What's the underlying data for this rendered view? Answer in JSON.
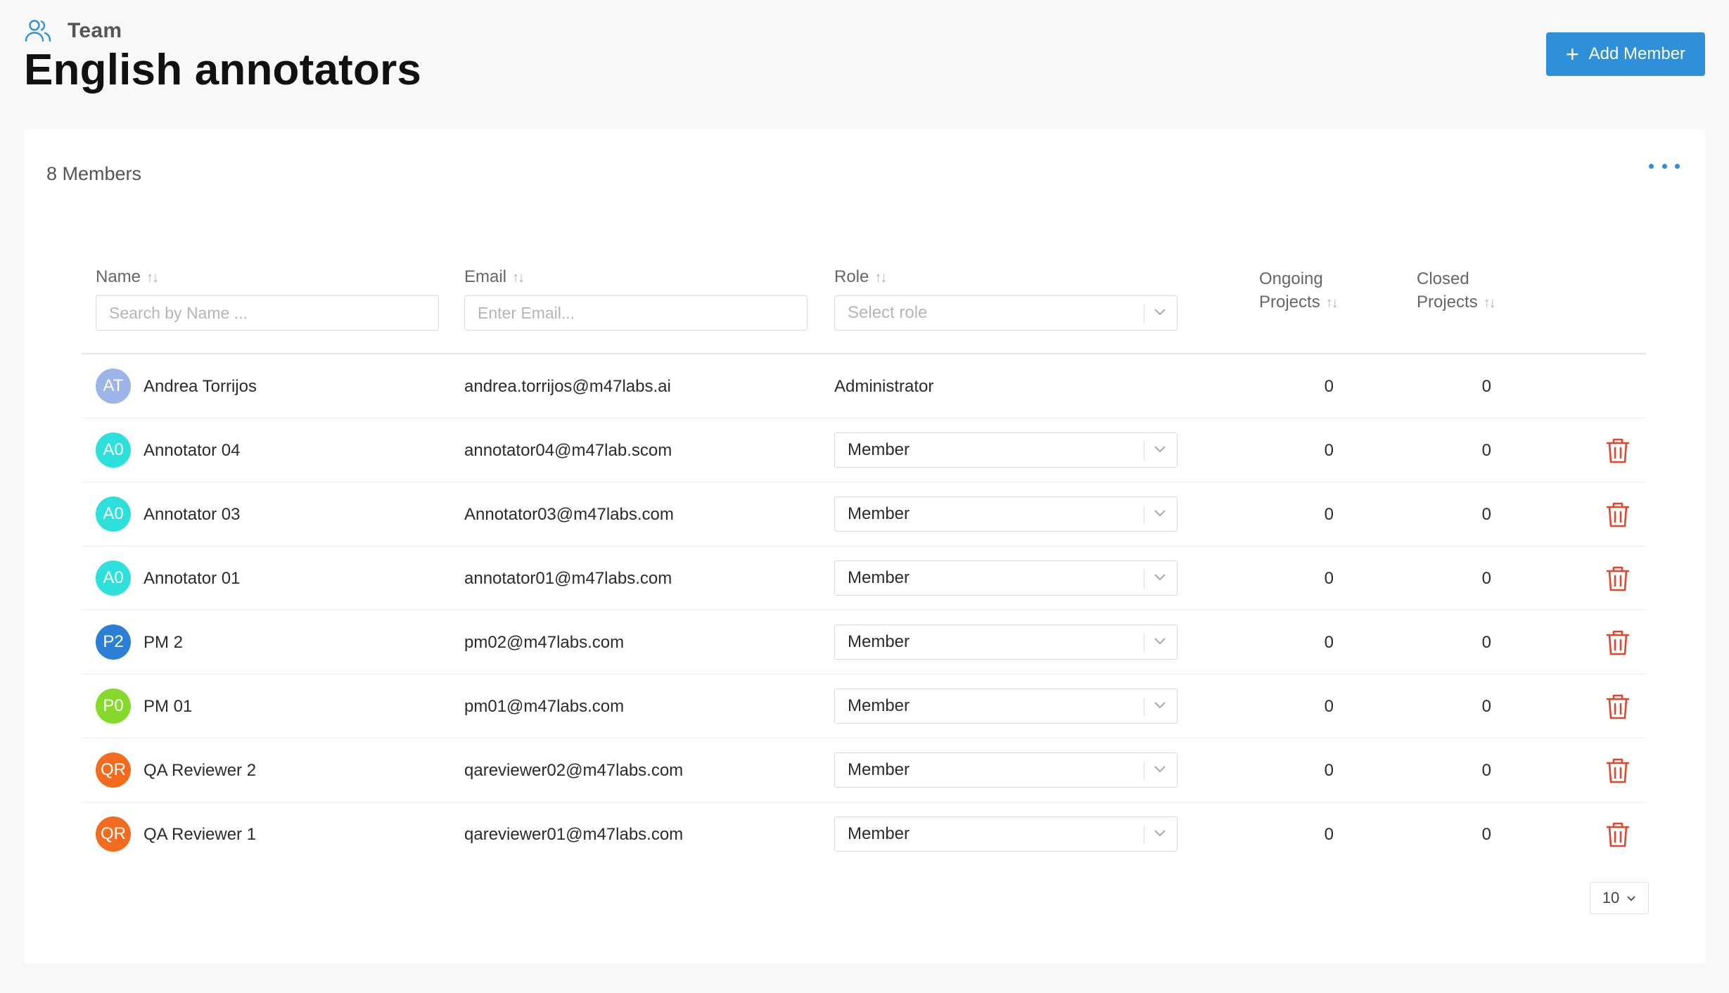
{
  "header": {
    "breadcrumb": "Team",
    "title": "English annotators",
    "add_button": "Add Member"
  },
  "card": {
    "members_count": "8 Members"
  },
  "table": {
    "columns": {
      "name": "Name",
      "email": "Email",
      "role": "Role",
      "ongoing_line1": "Ongoing",
      "ongoing_line2": "Projects",
      "closed_line1": "Closed",
      "closed_line2": "Projects"
    },
    "filters": {
      "name_placeholder": "Search by Name ...",
      "email_placeholder": "Enter Email...",
      "role_placeholder": "Select role"
    },
    "rows": [
      {
        "initials": "AT",
        "name": "Andrea Torrijos",
        "email": "andrea.torrijos@m47labs.ai",
        "role": "Administrator",
        "ongoing": "0",
        "closed": "0",
        "avatar_color": "#9db4e8",
        "role_editable": false
      },
      {
        "initials": "A0",
        "name": "Annotator 04",
        "email": "annotator04@m47lab.scom",
        "role": "Member",
        "ongoing": "0",
        "closed": "0",
        "avatar_color": "#2ee0dc",
        "role_editable": true
      },
      {
        "initials": "A0",
        "name": "Annotator 03",
        "email": "Annotator03@m47labs.com",
        "role": "Member",
        "ongoing": "0",
        "closed": "0",
        "avatar_color": "#2ee0dc",
        "role_editable": true
      },
      {
        "initials": "A0",
        "name": "Annotator 01",
        "email": "annotator01@m47labs.com",
        "role": "Member",
        "ongoing": "0",
        "closed": "0",
        "avatar_color": "#2ee0dc",
        "role_editable": true
      },
      {
        "initials": "P2",
        "name": "PM 2",
        "email": "pm02@m47labs.com",
        "role": "Member",
        "ongoing": "0",
        "closed": "0",
        "avatar_color": "#2b7fd4",
        "role_editable": true
      },
      {
        "initials": "P0",
        "name": "PM 01",
        "email": "pm01@m47labs.com",
        "role": "Member",
        "ongoing": "0",
        "closed": "0",
        "avatar_color": "#84d92a",
        "role_editable": true
      },
      {
        "initials": "QR",
        "name": "QA Reviewer 2",
        "email": "qareviewer02@m47labs.com",
        "role": "Member",
        "ongoing": "0",
        "closed": "0",
        "avatar_color": "#f36b1f",
        "role_editable": true
      },
      {
        "initials": "QR",
        "name": "QA Reviewer 1",
        "email": "qareviewer01@m47labs.com",
        "role": "Member",
        "ongoing": "0",
        "closed": "0",
        "avatar_color": "#f36b1f",
        "role_editable": true
      }
    ]
  },
  "pagination": {
    "page_size": "10"
  },
  "colors": {
    "accent": "#2f8fd8",
    "danger": "#e0452e"
  }
}
